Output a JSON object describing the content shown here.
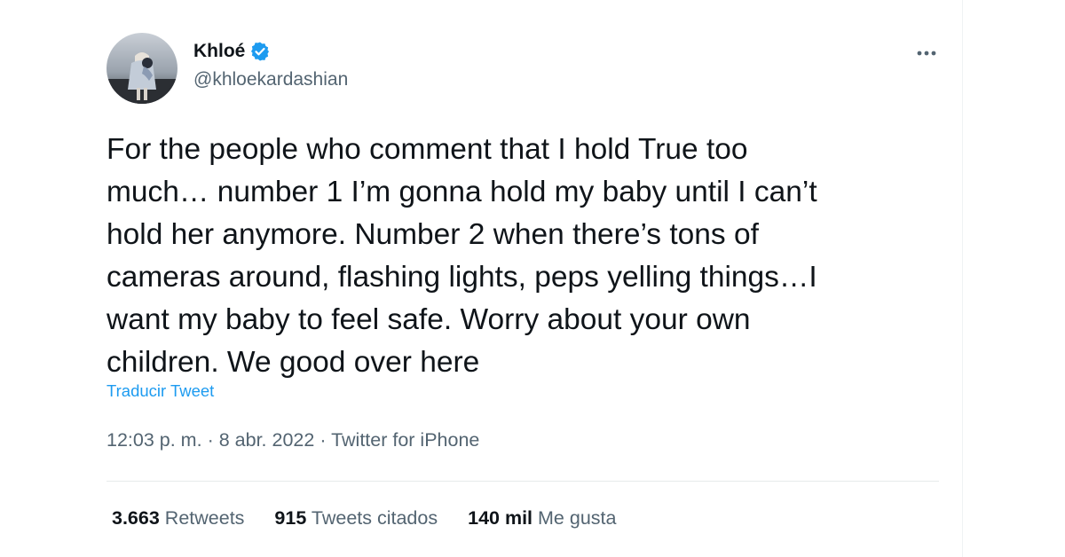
{
  "author": {
    "display_name": "Khloé",
    "handle": "@khloekardashian",
    "verified_color": "#1d9bf0"
  },
  "tweet": {
    "text": "For the people who comment that I hold True too\nmuch… number 1 I’m gonna hold my baby until I can’t\nhold her anymore. Number 2 when there’s tons of\ncameras around, flashing lights, peps yelling things…I\nwant my baby to feel safe. Worry about your own\nchildren. We good over here",
    "translate_label": "Traducir Tweet",
    "time": "12:03 p. m.",
    "date": "8 abr. 2022",
    "source": "Twitter for iPhone",
    "separator": "·"
  },
  "stats": {
    "retweets": {
      "count": "3.663",
      "label": "Retweets"
    },
    "quotes": {
      "count": "915",
      "label": "Tweets citados"
    },
    "likes": {
      "count": "140 mil",
      "label": "Me gusta"
    }
  },
  "icons": {
    "verified": "verified-badge-icon",
    "more": "more-options-icon"
  },
  "colors": {
    "text_primary": "#0f1419",
    "text_secondary": "#536471",
    "link": "#1d9bf0"
  }
}
